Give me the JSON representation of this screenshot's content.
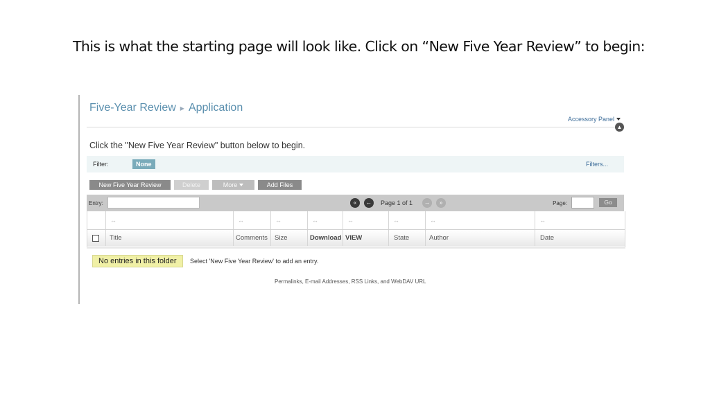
{
  "caption": "This is what the starting page will look like. Click on “New Five Year Review” to begin:",
  "breadcrumb": {
    "root": "Five-Year Review",
    "current": "Application"
  },
  "accessory_panel": "Accessory Panel",
  "intro_text": "Click the \"New Five Year Review\" button below to begin.",
  "filter": {
    "label": "Filter:",
    "value": "None",
    "filters_link": "Filters..."
  },
  "toolbar": {
    "new_label": "New Five Year Review",
    "delete_label": "Delete",
    "more_label": "More",
    "add_files_label": "Add Files"
  },
  "pager": {
    "entry_label": "Entry:",
    "entry_value": "",
    "page_info": "Page 1 of 1",
    "page_label": "Page:",
    "page_value": "",
    "go_label": "Go"
  },
  "grid": {
    "resize_glyph": "↔",
    "columns": [
      "Title",
      "Comments",
      "Size",
      "Download",
      "VIEW",
      "State",
      "Author",
      "Date"
    ]
  },
  "empty": {
    "badge": "No entries in this folder",
    "hint": "Select 'New Five Year Review' to add an entry."
  },
  "footer_links": "Permalinks, E-mail Addresses, RSS Links, and WebDAV URL"
}
